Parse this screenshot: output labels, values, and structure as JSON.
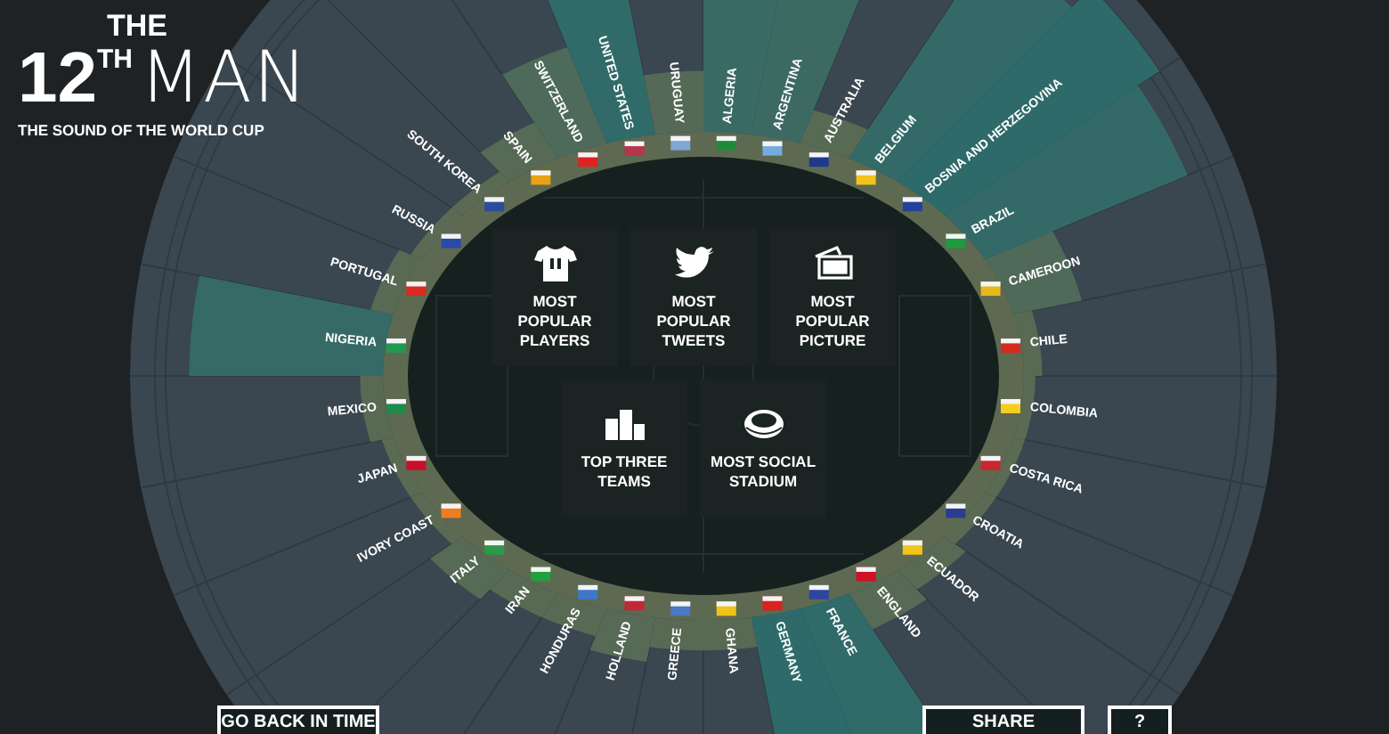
{
  "title": {
    "top": "THE",
    "number": "12$^{TH}$",
    "word": "MAN",
    "subtitle": "THE SOUND OF THE WORLD CUP"
  },
  "countries": [
    {
      "name": "ALGERIA",
      "color": "#1e8a3c"
    },
    {
      "name": "ARGENTINA",
      "color": "#74acdf"
    },
    {
      "name": "AUSTRALIA",
      "color": "#1f3a8a"
    },
    {
      "name": "BELGIUM",
      "color": "#f2c218"
    },
    {
      "name": "BOSNIA AND HERZEGOVINA",
      "color": "#23409a"
    },
    {
      "name": "BRAZIL",
      "color": "#1f9a3f"
    },
    {
      "name": "CAMEROON",
      "color": "#e7b81c"
    },
    {
      "name": "CHILE",
      "color": "#d52b1e"
    },
    {
      "name": "COLOMBIA",
      "color": "#f5cf1b"
    },
    {
      "name": "COSTA RICA",
      "color": "#c8282e"
    },
    {
      "name": "CROATIA",
      "color": "#2b3c94"
    },
    {
      "name": "ECUADOR",
      "color": "#f2c618"
    },
    {
      "name": "ENGLAND",
      "color": "#ce1124"
    },
    {
      "name": "FRANCE",
      "color": "#2c46a0"
    },
    {
      "name": "GERMANY",
      "color": "#dd2020"
    },
    {
      "name": "GHANA",
      "color": "#f1c21a"
    },
    {
      "name": "GREECE",
      "color": "#4a78c2"
    },
    {
      "name": "HOLLAND",
      "color": "#c0283a"
    },
    {
      "name": "HONDURAS",
      "color": "#3f77c9"
    },
    {
      "name": "IRAN",
      "color": "#239f40"
    },
    {
      "name": "ITALY",
      "color": "#2a9a48"
    },
    {
      "name": "IVORY COAST",
      "color": "#f07c20"
    },
    {
      "name": "JAPAN",
      "color": "#c8102e"
    },
    {
      "name": "MEXICO",
      "color": "#1e8a4a"
    },
    {
      "name": "NIGERIA",
      "color": "#1e9a50"
    },
    {
      "name": "PORTUGAL",
      "color": "#da2a1f"
    },
    {
      "name": "RUSSIA",
      "color": "#2b4aa8"
    },
    {
      "name": "SOUTH KOREA",
      "color": "#2c4c9c"
    },
    {
      "name": "SPAIN",
      "color": "#e8a212"
    },
    {
      "name": "SWITZERLAND",
      "color": "#dd2222"
    },
    {
      "name": "UNITED STATES",
      "color": "#b5364a"
    },
    {
      "name": "URUGUAY",
      "color": "#7ea6d6"
    }
  ],
  "menu": [
    {
      "label": "MOST POPULAR PLAYERS",
      "kind": "shirt"
    },
    {
      "label": "MOST POPULAR TWEETS",
      "kind": "bird"
    },
    {
      "label": "MOST POPULAR PICTURE",
      "kind": "photos"
    },
    {
      "label": "TOP THREE TEAMS",
      "kind": "podium"
    },
    {
      "label": "MOST SOCIAL STADIUM",
      "kind": "stadium"
    }
  ],
  "buttons": [
    "GO BACK IN TIME",
    "SHARE",
    "?"
  ]
}
